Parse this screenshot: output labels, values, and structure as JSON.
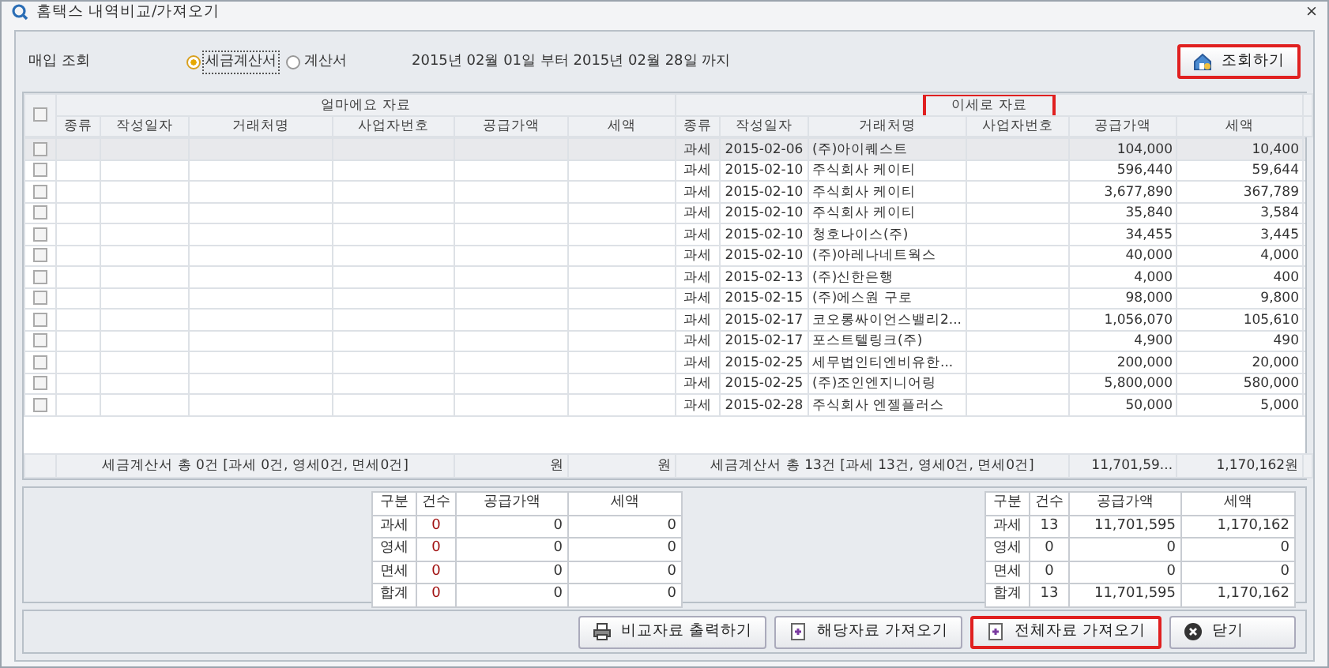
{
  "window": {
    "title": "홈택스 내역비교/가져오기",
    "close": "×"
  },
  "query": {
    "label": "매입 조회",
    "options": [
      {
        "label": "세금계산서",
        "selected": true
      },
      {
        "label": "계산서",
        "selected": false
      }
    ],
    "period": "2015년 02월 01일 부터 2015년 02월 28일 까지",
    "search_button": {
      "label": "조회하기",
      "highlighted": true
    }
  },
  "grid": {
    "all_checked": false,
    "groups": [
      {
        "label": "얼마에요 자료",
        "highlighted": false
      },
      {
        "label": "이세로 자료",
        "highlighted": true
      }
    ],
    "columns": [
      "종류",
      "작성일자",
      "거래처명",
      "사업자번호",
      "공급가액",
      "세액",
      "종류",
      "작성일자",
      "거래처명",
      "사업자번호",
      "공급가액",
      "세액"
    ],
    "rows": [
      {
        "selected": true,
        "checked": false,
        "type": "과세",
        "date": "2015-02-06",
        "partner": "(주)아이퀘스트",
        "supply": "104,000",
        "tax": "10,400"
      },
      {
        "selected": false,
        "checked": false,
        "type": "과세",
        "date": "2015-02-10",
        "partner": "주식회사 케이티",
        "supply": "596,440",
        "tax": "59,644"
      },
      {
        "selected": false,
        "checked": false,
        "type": "과세",
        "date": "2015-02-10",
        "partner": "주식회사 케이티",
        "supply": "3,677,890",
        "tax": "367,789"
      },
      {
        "selected": false,
        "checked": false,
        "type": "과세",
        "date": "2015-02-10",
        "partner": "주식회사 케이티",
        "supply": "35,840",
        "tax": "3,584"
      },
      {
        "selected": false,
        "checked": false,
        "type": "과세",
        "date": "2015-02-10",
        "partner": "청호나이스(주)",
        "supply": "34,455",
        "tax": "3,445"
      },
      {
        "selected": false,
        "checked": false,
        "type": "과세",
        "date": "2015-02-10",
        "partner": "(주)아레나네트웍스",
        "supply": "40,000",
        "tax": "4,000"
      },
      {
        "selected": false,
        "checked": false,
        "type": "과세",
        "date": "2015-02-13",
        "partner": "(주)신한은행",
        "supply": "4,000",
        "tax": "400"
      },
      {
        "selected": false,
        "checked": false,
        "type": "과세",
        "date": "2015-02-15",
        "partner": "(주)에스원 구로",
        "supply": "98,000",
        "tax": "9,800"
      },
      {
        "selected": false,
        "checked": false,
        "type": "과세",
        "date": "2015-02-17",
        "partner": "코오롱싸이언스밸리2...",
        "supply": "1,056,070",
        "tax": "105,610"
      },
      {
        "selected": false,
        "checked": false,
        "type": "과세",
        "date": "2015-02-17",
        "partner": "포스트텔링크(주)",
        "supply": "4,900",
        "tax": "490"
      },
      {
        "selected": false,
        "checked": false,
        "type": "과세",
        "date": "2015-02-25",
        "partner": "세무법인티엔비유한...",
        "supply": "200,000",
        "tax": "20,000"
      },
      {
        "selected": false,
        "checked": false,
        "type": "과세",
        "date": "2015-02-25",
        "partner": "(주)조인엔지니어링",
        "supply": "5,800,000",
        "tax": "580,000"
      },
      {
        "selected": false,
        "checked": false,
        "type": "과세",
        "date": "2015-02-28",
        "partner": "주식회사 엔젤플러스",
        "supply": "50,000",
        "tax": "5,000"
      }
    ],
    "footer": [
      "세금계산서 총 0건 [과세 0건, 영세0건, 면세0건]",
      "원",
      "원",
      "세금계산서 총 13건 [과세 13건, 영세0건, 면세0건]",
      "11,701,59...",
      "1,170,162원"
    ]
  },
  "summaries": [
    {
      "columns": [
        "구분",
        "건수",
        "공급가액",
        "세액"
      ],
      "rows": [
        [
          "과세",
          "0",
          "0",
          "0"
        ],
        [
          "영세",
          "0",
          "0",
          "0"
        ],
        [
          "면세",
          "0",
          "0",
          "0"
        ],
        [
          "합계",
          "0",
          "0",
          "0"
        ]
      ]
    },
    {
      "columns": [
        "구분",
        "건수",
        "공급가액",
        "세액"
      ],
      "rows": [
        [
          "과세",
          "13",
          "11,701,595",
          "1,170,162"
        ],
        [
          "영세",
          "0",
          "0",
          "0"
        ],
        [
          "면세",
          "0",
          "0",
          "0"
        ],
        [
          "합계",
          "13",
          "11,701,595",
          "1,170,162"
        ]
      ]
    }
  ],
  "buttons": [
    {
      "label": "비교자료 출력하기",
      "kind": "print",
      "highlighted": false
    },
    {
      "label": "해당자료 가져오기",
      "kind": "import",
      "highlighted": false
    },
    {
      "label": "전체자료 가져오기",
      "kind": "import",
      "highlighted": true
    },
    {
      "label": "닫기",
      "kind": "close",
      "highlighted": false
    }
  ]
}
